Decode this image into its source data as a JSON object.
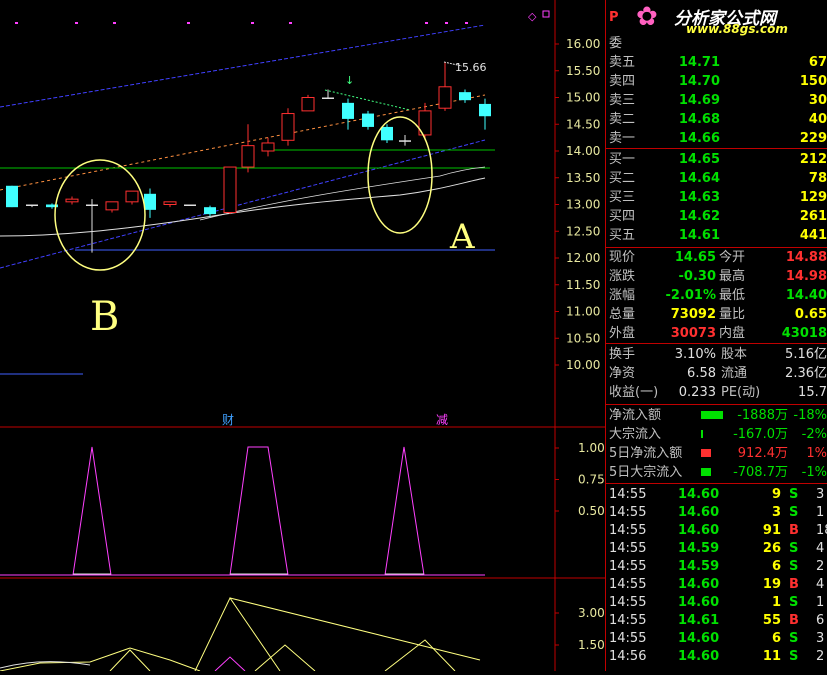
{
  "logo": {
    "title": "分析家公式网",
    "url": "www.88gs.com",
    "p_label": "P"
  },
  "main_chart": {
    "y_ticks": [
      "16.00",
      "15.50",
      "15.00",
      "14.50",
      "14.00",
      "13.50",
      "13.00",
      "12.50",
      "12.00",
      "11.50",
      "11.00",
      "10.50",
      "10.00"
    ],
    "high_label": "15.66",
    "annot_a": "A",
    "annot_b": "B",
    "marker_cai": "财",
    "marker_jian": "减"
  },
  "indicator1": {
    "y_ticks": [
      "1.00",
      "0.75",
      "0.50"
    ]
  },
  "indicator2": {
    "y_ticks": [
      "3.00",
      "1.50"
    ]
  },
  "order_book": {
    "header": "委",
    "asks": [
      {
        "label": "卖五",
        "price": "14.71",
        "vol": "67"
      },
      {
        "label": "卖四",
        "price": "14.70",
        "vol": "150"
      },
      {
        "label": "卖三",
        "price": "14.69",
        "vol": "30"
      },
      {
        "label": "卖二",
        "price": "14.68",
        "vol": "40"
      },
      {
        "label": "卖一",
        "price": "14.66",
        "vol": "229"
      }
    ],
    "bids": [
      {
        "label": "买一",
        "price": "14.65",
        "vol": "212"
      },
      {
        "label": "买二",
        "price": "14.64",
        "vol": "78"
      },
      {
        "label": "买三",
        "price": "14.63",
        "vol": "129"
      },
      {
        "label": "买四",
        "price": "14.62",
        "vol": "261"
      },
      {
        "label": "买五",
        "price": "14.61",
        "vol": "441"
      }
    ]
  },
  "quote": {
    "rows": [
      {
        "l1": "现价",
        "v1": "14.65",
        "c1": "green",
        "l2": "今开",
        "v2": "14.88",
        "c2": "red"
      },
      {
        "l1": "涨跌",
        "v1": "-0.30",
        "c1": "green",
        "l2": "最高",
        "v2": "14.98",
        "c2": "red"
      },
      {
        "l1": "涨幅",
        "v1": "-2.01%",
        "c1": "green",
        "l2": "最低",
        "v2": "14.40",
        "c2": "green"
      },
      {
        "l1": "总量",
        "v1": "73092",
        "c1": "yellow",
        "l2": "量比",
        "v2": "0.65",
        "c2": "yellow"
      },
      {
        "l1": "外盘",
        "v1": "30073",
        "c1": "red",
        "l2": "内盘",
        "v2": "43018",
        "c2": "green"
      }
    ]
  },
  "fundamentals": {
    "rows": [
      {
        "l1": "换手",
        "v1": "3.10%",
        "l2": "股本",
        "v2": "5.16亿"
      },
      {
        "l1": "净资",
        "v1": "6.58",
        "l2": "流通",
        "v2": "2.36亿"
      },
      {
        "l1": "收益(一)",
        "v1": "0.233",
        "l2": "PE(动)",
        "v2": "15.7"
      }
    ]
  },
  "flows": [
    {
      "label": "净流入额",
      "value": "-1888万",
      "pct": "-18%",
      "color": "green"
    },
    {
      "label": "大宗流入",
      "value": "-167.0万",
      "pct": "-2%",
      "color": "green"
    },
    {
      "label": "5日净流入额",
      "value": "912.4万",
      "pct": "1%",
      "color": "red"
    },
    {
      "label": "5日大宗流入",
      "value": "-708.7万",
      "pct": "-1%",
      "color": "green"
    }
  ],
  "ticks": [
    {
      "time": "14:55",
      "price": "14.60",
      "vol": "9",
      "side": "S",
      "n": "3"
    },
    {
      "time": "14:55",
      "price": "14.60",
      "vol": "3",
      "side": "S",
      "n": "1"
    },
    {
      "time": "14:55",
      "price": "14.60",
      "vol": "91",
      "side": "B",
      "n": "18"
    },
    {
      "time": "14:55",
      "price": "14.59",
      "vol": "26",
      "side": "S",
      "n": "4"
    },
    {
      "time": "14:55",
      "price": "14.59",
      "vol": "6",
      "side": "S",
      "n": "2"
    },
    {
      "time": "14:55",
      "price": "14.60",
      "vol": "19",
      "side": "B",
      "n": "4"
    },
    {
      "time": "14:55",
      "price": "14.60",
      "vol": "1",
      "side": "S",
      "n": "1"
    },
    {
      "time": "14:55",
      "price": "14.61",
      "vol": "55",
      "side": "B",
      "n": "6"
    },
    {
      "time": "14:55",
      "price": "14.60",
      "vol": "6",
      "side": "S",
      "n": "3"
    },
    {
      "time": "14:56",
      "price": "14.60",
      "vol": "11",
      "side": "S",
      "n": "2"
    }
  ],
  "colors": {
    "up": "#ff3030",
    "down": "#40ffff",
    "grid": "#c00000",
    "axis_text": "#e8e8a0"
  }
}
